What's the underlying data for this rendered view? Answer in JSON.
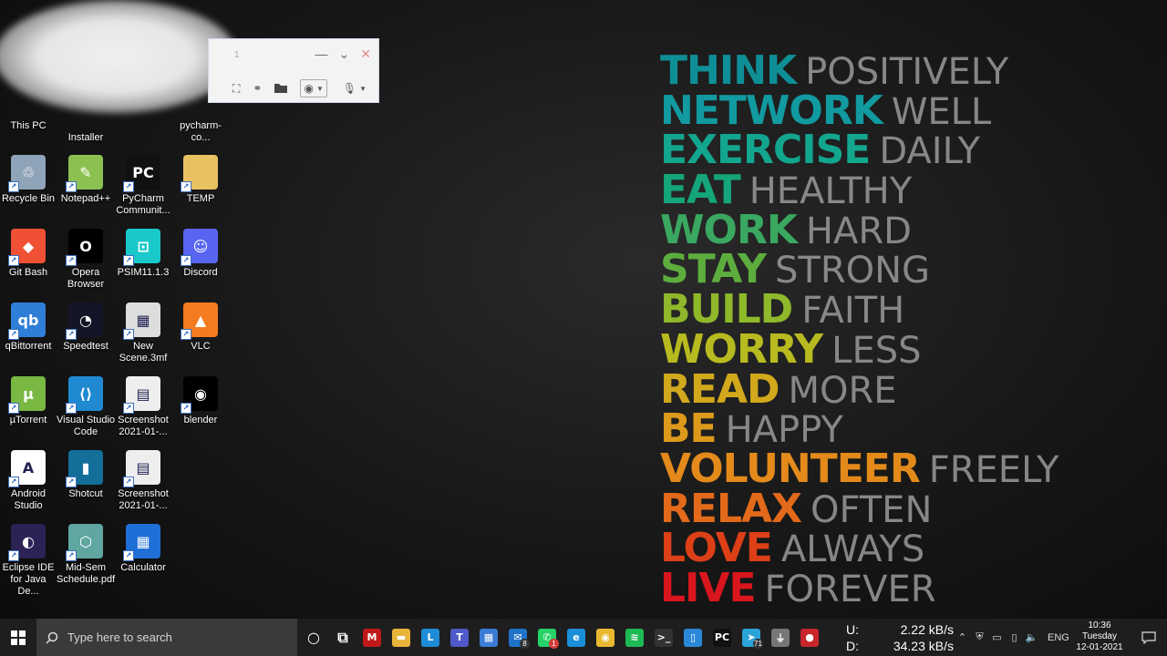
{
  "wallpaper": {
    "rows": [
      {
        "bold": "THINK",
        "thin": "POSITIVELY",
        "color": "#0e8f96"
      },
      {
        "bold": "NETWORK",
        "thin": "WELL",
        "color": "#119aa0"
      },
      {
        "bold": "EXERCISE",
        "thin": "DAILY",
        "color": "#13a68f"
      },
      {
        "bold": "EAT",
        "thin": "HEALTHY",
        "color": "#14a57a"
      },
      {
        "bold": "WORK",
        "thin": "HARD",
        "color": "#3aa860"
      },
      {
        "bold": "STAY",
        "thin": "STRONG",
        "color": "#5cad3e"
      },
      {
        "bold": "BUILD",
        "thin": "FAITH",
        "color": "#8fb82a"
      },
      {
        "bold": "WORRY",
        "thin": "LESS",
        "color": "#b8bb1f"
      },
      {
        "bold": "READ",
        "thin": "MORE",
        "color": "#d2a81c"
      },
      {
        "bold": "BE",
        "thin": "HAPPY",
        "color": "#dd9a1a"
      },
      {
        "bold": "VOLUNTEER",
        "thin": "FREELY",
        "color": "#e38a1b"
      },
      {
        "bold": "RELAX",
        "thin": "OFTEN",
        "color": "#e26a1a"
      },
      {
        "bold": "LOVE",
        "thin": "ALWAYS",
        "color": "#dd3f17"
      },
      {
        "bold": "LIVE",
        "thin": "FOREVER",
        "color": "#d9161d"
      }
    ]
  },
  "desktop": {
    "icons": [
      {
        "label": "This PC",
        "icon": "this-pc-icon"
      },
      {
        "label": "Installer",
        "icon": "installer-icon"
      },
      {
        "label": "pycharm-co...",
        "icon": "pycharm-shortcut-icon"
      },
      {
        "label": "Recycle Bin",
        "icon": "recycle-bin-icon"
      },
      {
        "label": "Notepad++",
        "icon": "notepadpp-icon"
      },
      {
        "label": "PyCharm Communit...",
        "icon": "pycharm-icon"
      },
      {
        "label": "TEMP",
        "icon": "folder-icon"
      },
      {
        "label": "Git Bash",
        "icon": "git-bash-icon"
      },
      {
        "label": "Opera Browser",
        "icon": "opera-icon"
      },
      {
        "label": "PSIM11.1.3",
        "icon": "psim-icon"
      },
      {
        "label": "Discord",
        "icon": "discord-icon"
      },
      {
        "label": "qBittorrent",
        "icon": "qbittorrent-icon"
      },
      {
        "label": "Speedtest",
        "icon": "speedtest-icon"
      },
      {
        "label": "New Scene.3mf",
        "icon": "3mf-file-icon"
      },
      {
        "label": "VLC",
        "icon": "vlc-icon"
      },
      {
        "label": "µTorrent",
        "icon": "utorrent-icon"
      },
      {
        "label": "Visual Studio Code",
        "icon": "vscode-icon"
      },
      {
        "label": "Screenshot 2021-01-...",
        "icon": "screenshot-file-icon"
      },
      {
        "label": "blender",
        "icon": "blender-icon"
      },
      {
        "label": "Android Studio",
        "icon": "android-studio-icon"
      },
      {
        "label": "Shotcut",
        "icon": "shotcut-icon"
      },
      {
        "label": "Screenshot 2021-01-...",
        "icon": "screenshot-file-icon"
      },
      {
        "label": "Eclipse IDE for Java De...",
        "icon": "eclipse-icon"
      },
      {
        "label": "Mid-Sem Schedule.pdf",
        "icon": "pdf-file-icon"
      },
      {
        "label": "Calculator",
        "icon": "calculator-icon"
      }
    ]
  },
  "mini_toolbar": {
    "counter": "1"
  },
  "taskbar": {
    "search_placeholder": "Type here to search",
    "pinned": [
      {
        "icon": "cortana-icon"
      },
      {
        "icon": "task-view-icon"
      },
      {
        "icon": "mcafee-icon"
      },
      {
        "icon": "file-explorer-icon"
      },
      {
        "icon": "lens-app-icon"
      },
      {
        "icon": "teams-icon"
      },
      {
        "icon": "calculator-icon"
      },
      {
        "icon": "mail-icon",
        "badge": "8"
      },
      {
        "icon": "whatsapp-icon",
        "badge": "1"
      },
      {
        "icon": "edge-icon"
      },
      {
        "icon": "chrome-icon"
      },
      {
        "icon": "spotify-icon"
      },
      {
        "icon": "terminal-icon"
      },
      {
        "icon": "phone-app-icon"
      },
      {
        "icon": "pycharm-icon"
      },
      {
        "icon": "telegram-icon",
        "badge": "71"
      },
      {
        "icon": "usb-icon"
      },
      {
        "icon": "recorder-icon"
      }
    ],
    "network": {
      "upload_label": "U:",
      "upload_value": "2.22 kB/s",
      "download_label": "D:",
      "download_value": "34.23 kB/s"
    },
    "language": "ENG",
    "clock": {
      "time": "10:36",
      "day": "Tuesday",
      "date": "12-01-2021"
    }
  }
}
